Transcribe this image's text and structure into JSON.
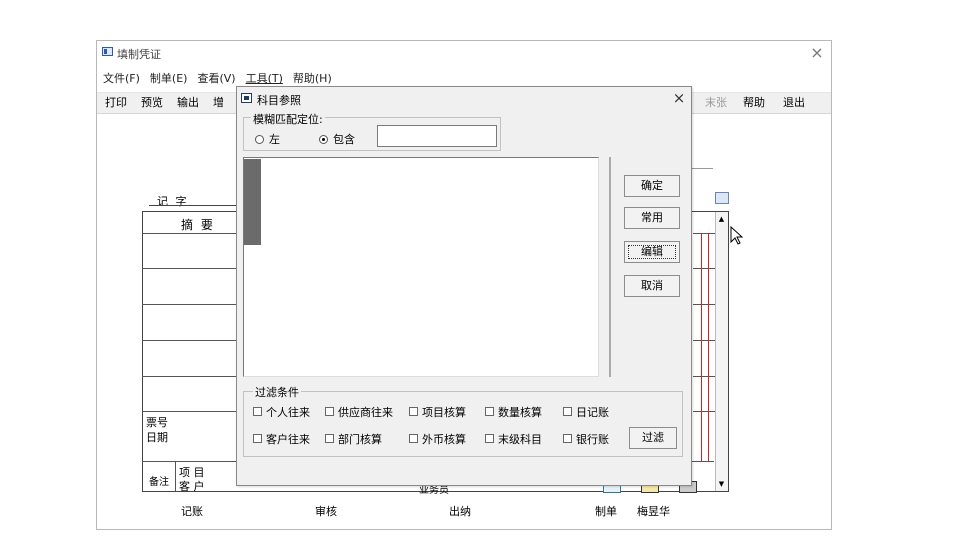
{
  "window": {
    "title": "填制凭证",
    "close_glyph": "×"
  },
  "menu": [
    "文件(F)",
    "制单(E)",
    "查看(V)",
    "工具(T)",
    "帮助(H)"
  ],
  "toolbar": {
    "left": [
      "打印",
      "预览",
      "输出",
      "增"
    ],
    "right": [
      {
        "label": "末张",
        "enabled": false
      },
      {
        "label": "帮助",
        "enabled": true
      },
      {
        "label": "退出",
        "enabled": true
      }
    ]
  },
  "voucher": {
    "type_label": "记  字",
    "summary_header": "摘 要",
    "ticket_no": "票号",
    "date": "日期",
    "remark": "备注",
    "project": "项 目",
    "customer": "客 户",
    "salesman": "业务员",
    "footer": {
      "bookkeeping": "记账",
      "audit": "审核",
      "cashier": "出纳",
      "maker_label": "制单",
      "maker_name": "梅昱华"
    }
  },
  "dialog": {
    "title": "科目参照",
    "close_glyph": "×",
    "fuzzy_group": "模糊匹配定位:",
    "radio_left": "左",
    "radio_contains": "包含",
    "match_mode": "contains",
    "search_value": "",
    "buttons": {
      "ok": "确定",
      "common": "常用",
      "edit": "编辑",
      "cancel": "取消",
      "filter": "过滤"
    },
    "filter_group": "过滤条件",
    "filters": [
      [
        "个人往来",
        "供应商往来",
        "项目核算",
        "数量核算",
        "日记账"
      ],
      [
        "客户往来",
        "部门核算",
        "外币核算",
        "末级科目",
        "银行账"
      ]
    ]
  },
  "colors": {
    "accent_blue": "#2a5aa8",
    "red_line": "#d42020",
    "dialog_bg": "#f0f0f0"
  }
}
